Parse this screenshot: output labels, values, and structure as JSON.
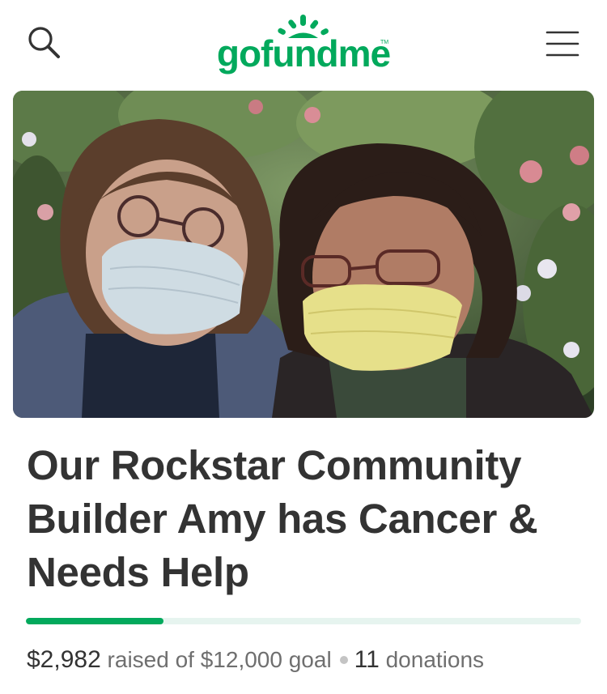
{
  "header": {
    "logo_text": "gofundme",
    "search_icon": "search-icon",
    "menu_icon": "hamburger-menu-icon"
  },
  "campaign": {
    "title": "Our Rockstar Community Builder Amy has Cancer & Needs Help",
    "image_alt": "Two women wearing face masks and glasses standing in front of flowering shrubs",
    "raised": "$2,982",
    "raised_of_text": "raised of",
    "goal": "$12,000",
    "goal_text": "goal",
    "donations_count": "11",
    "donations_text": "donations",
    "progress_fraction": 0.2485
  },
  "colors": {
    "brand_green": "#02a95c",
    "progress_track": "#e6f4ef",
    "text_dark": "#333333",
    "text_muted": "#6f6f6f"
  }
}
